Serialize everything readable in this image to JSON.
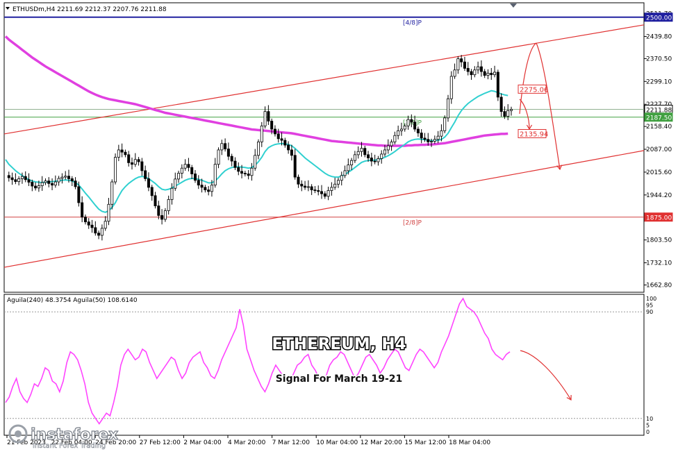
{
  "header": {
    "symbol_info": "ETHUSDm,H4  2211.69 2212.37 2207.76 2211.88",
    "indicator_info": "Aguila(240) 48.3754  Aguila(50) 108.6140"
  },
  "overlay": {
    "title": "ETHEREUM, H4",
    "subtitle": "Signal For March 19-21",
    "brand_name": "instaforex",
    "brand_tagline": "Instant Forex Trading"
  },
  "colors": {
    "ema200": "#e040e0",
    "ema21": "#30d0d0",
    "channel": "#e03030",
    "level_line": "#2020a0",
    "support_line": "#d04040",
    "current_price_line": "#40a040",
    "indicator": "#ff44ff",
    "arrow": "#e03030"
  },
  "chart_data": [
    {
      "type": "candlestick",
      "title": "ETHUSDm,H4",
      "ylim": [
        1640,
        2545
      ],
      "price_ticks": [
        "2511.70",
        "2439.80",
        "2370.50",
        "2299.10",
        "2227.70",
        "2158.40",
        "2087.00",
        "2015.60",
        "1944.20",
        "1873.90",
        "1803.50",
        "1732.10",
        "1662.80"
      ],
      "x_ticks": [
        "21 Feb 2023",
        "22 Feb 04:00",
        "24 Feb 20:00",
        "27 Feb 12:00",
        "2 Mar 04:00",
        "4 Mar 20:00",
        "7 Mar 12:00",
        "10 Mar 04:00",
        "12 Mar 20:00",
        "15 Mar 12:00",
        "18 Mar 04:00"
      ],
      "murray_levels": [
        {
          "label": "[4/8]P",
          "price": 2500.0,
          "tag": "2500.00"
        },
        {
          "label": "[3/8]P",
          "price": 2187.5,
          "tag": "2187.50"
        },
        {
          "label": "[2/8]P",
          "price": 1875.0,
          "tag": "1875.00"
        }
      ],
      "current_price": {
        "value": 2211.88,
        "tag": "2211.88"
      },
      "price_annotations": [
        {
          "value": 2275.06,
          "tag": "2275.06"
        },
        {
          "value": 2135.94,
          "tag": "2135.94"
        }
      ],
      "close_series": [
        2005,
        1998,
        1992,
        1986,
        1995,
        2002,
        1992,
        1984,
        1972,
        1966,
        1973,
        1983,
        1988,
        1980,
        1975,
        1985,
        1996,
        2000,
        2003,
        1995,
        1988,
        1970,
        1920,
        1875,
        1860,
        1850,
        1842,
        1825,
        1818,
        1840,
        1862,
        1915,
        1985,
        2062,
        2085,
        2078,
        2070,
        2045,
        2040,
        2055,
        2048,
        2020,
        1995,
        1968,
        1942,
        1910,
        1880,
        1868,
        1895,
        1930,
        1965,
        1994,
        2012,
        2028,
        2040,
        2030,
        2010,
        1990,
        1975,
        1968,
        1960,
        1955,
        1975,
        2040,
        2085,
        2105,
        2088,
        2065,
        2050,
        2030,
        2018,
        2012,
        2010,
        2005,
        2028,
        2068,
        2110,
        2160,
        2205,
        2175,
        2150,
        2135,
        2120,
        2115,
        2100,
        2085,
        2068,
        2000,
        1978,
        1972,
        1968,
        1970,
        1960,
        1958,
        1955,
        1948,
        1940,
        1958,
        1968,
        1978,
        1990,
        2005,
        2020,
        2038,
        2052,
        2070,
        2080,
        2090,
        2070,
        2060,
        2050,
        2048,
        2058,
        2072,
        2085,
        2098,
        2110,
        2130,
        2145,
        2150,
        2160,
        2180,
        2172,
        2150,
        2138,
        2122,
        2118,
        2110,
        2112,
        2118,
        2128,
        2145,
        2185,
        2245,
        2315,
        2335,
        2370,
        2360,
        2340,
        2330,
        2320,
        2335,
        2345,
        2330,
        2318,
        2325,
        2320,
        2328,
        2250,
        2205,
        2190,
        2208,
        2212
      ],
      "ema21_series": [
        2055,
        2040,
        2030,
        2020,
        2012,
        2005,
        1998,
        1992,
        1988,
        1985,
        1984,
        1983,
        1984,
        1985,
        1986,
        1987,
        1989,
        1990,
        1991,
        1990,
        1988,
        1983,
        1975,
        1963,
        1950,
        1938,
        1925,
        1912,
        1900,
        1893,
        1890,
        1895,
        1905,
        1920,
        1940,
        1958,
        1970,
        1980,
        1988,
        1995,
        2000,
        2002,
        2000,
        1995,
        1988,
        1980,
        1970,
        1962,
        1960,
        1962,
        1966,
        1972,
        1978,
        1984,
        1990,
        1994,
        1996,
        1995,
        1993,
        1990,
        1986,
        1982,
        1982,
        1988,
        1998,
        2010,
        2020,
        2026,
        2030,
        2032,
        2032,
        2031,
        2030,
        2028,
        2030,
        2037,
        2048,
        2062,
        2080,
        2092,
        2098,
        2102,
        2104,
        2105,
        2104,
        2102,
        2098,
        2090,
        2080,
        2070,
        2060,
        2052,
        2044,
        2036,
        2028,
        2020,
        2012,
        2006,
        2002,
        2000,
        2000,
        2003,
        2008,
        2015,
        2022,
        2030,
        2038,
        2046,
        2050,
        2052,
        2053,
        2053,
        2055,
        2058,
        2062,
        2067,
        2073,
        2080,
        2088,
        2095,
        2102,
        2110,
        2115,
        2118,
        2119,
        2118,
        2117,
        2115,
        2114,
        2114,
        2115,
        2118,
        2125,
        2137,
        2155,
        2172,
        2192,
        2208,
        2220,
        2230,
        2238,
        2245,
        2252,
        2257,
        2262,
        2266,
        2270,
        2268,
        2264,
        2260,
        2257,
        2255
      ],
      "ema200_series": [
        2440,
        2430,
        2422,
        2414,
        2406,
        2398,
        2390,
        2382,
        2374,
        2367,
        2360,
        2353,
        2346,
        2340,
        2334,
        2328,
        2322,
        2316,
        2310,
        2304,
        2298,
        2292,
        2286,
        2280,
        2274,
        2268,
        2263,
        2258,
        2254,
        2250,
        2247,
        2244,
        2242,
        2240,
        2238,
        2236,
        2234,
        2232,
        2230,
        2228,
        2225,
        2222,
        2219,
        2216,
        2213,
        2210,
        2207,
        2204,
        2201,
        2199,
        2197,
        2195,
        2193,
        2191,
        2189,
        2187,
        2185,
        2183,
        2181,
        2179,
        2177,
        2175,
        2173,
        2171,
        2169,
        2167,
        2165,
        2163,
        2161,
        2159,
        2157,
        2155,
        2153,
        2151,
        2149,
        2148,
        2147,
        2146,
        2145,
        2144,
        2143,
        2142,
        2141,
        2140,
        2139,
        2138,
        2137,
        2135,
        2133,
        2131,
        2129,
        2127,
        2125,
        2123,
        2121,
        2119,
        2117,
        2115,
        2113,
        2112,
        2111,
        2110,
        2109,
        2108,
        2107,
        2106,
        2105,
        2104,
        2103,
        2102,
        2101,
        2100,
        2099,
        2099,
        2098,
        2098,
        2098,
        2098,
        2098,
        2098,
        2098,
        2099,
        2099,
        2100,
        2100,
        2101,
        2101,
        2102,
        2102,
        2103,
        2104,
        2105,
        2106,
        2108,
        2110,
        2112,
        2114,
        2116,
        2118,
        2120,
        2122,
        2124,
        2126,
        2128,
        2130,
        2131,
        2132,
        2133,
        2134,
        2135,
        2135,
        2136
      ]
    },
    {
      "type": "line",
      "title": "Aguila(240) 48.3754  Aguila(50) 108.6140",
      "ylim": [
        0,
        100
      ],
      "y_ticks": [
        "100",
        "95",
        "90",
        "10",
        "5",
        "0"
      ],
      "series": [
        {
          "name": "Aguila(50)",
          "values": [
            22,
            26,
            34,
            40,
            30,
            25,
            22,
            28,
            36,
            34,
            40,
            48,
            46,
            38,
            36,
            30,
            38,
            52,
            60,
            58,
            54,
            46,
            36,
            22,
            14,
            10,
            6,
            10,
            14,
            12,
            22,
            34,
            50,
            58,
            62,
            58,
            54,
            56,
            62,
            60,
            52,
            46,
            40,
            44,
            48,
            52,
            56,
            54,
            46,
            40,
            44,
            52,
            56,
            58,
            60,
            52,
            48,
            42,
            40,
            46,
            54,
            60,
            66,
            72,
            78,
            92,
            80,
            62,
            54,
            46,
            40,
            34,
            30,
            36,
            44,
            50,
            46,
            42,
            40,
            38,
            44,
            50,
            52,
            56,
            58,
            50,
            46,
            40,
            38,
            42,
            50,
            54,
            56,
            60,
            58,
            52,
            46,
            40,
            44,
            50,
            56,
            58,
            54,
            50,
            44,
            48,
            54,
            58,
            62,
            60,
            54,
            48,
            46,
            52,
            58,
            62,
            60,
            56,
            52,
            48,
            52,
            60,
            66,
            72,
            80,
            88,
            96,
            100,
            94,
            92,
            90,
            86,
            80,
            74,
            70,
            62,
            58,
            56,
            54,
            58,
            60
          ]
        }
      ]
    }
  ]
}
